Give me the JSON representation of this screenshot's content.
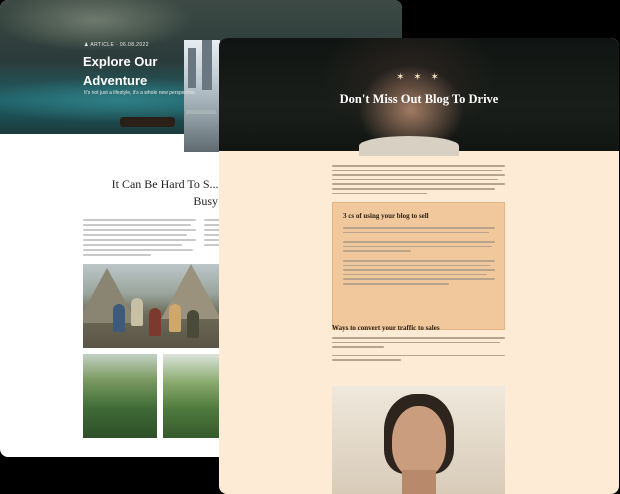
{
  "back_page": {
    "meta": "♟ ARTICLE   ·   06.08.2022",
    "hero_title": "Explore Our Adventure",
    "hero_subtitle": "It's not just a lifestyle, it's a whole new perspective.",
    "section_heading": "It Can Be Hard To S... The Busy W..."
  },
  "front_page": {
    "ornament": "✶ ✶ ✶",
    "hero_title": "Don't Miss Out Blog To Drive",
    "box_title": "3 cs of using your blog to sell",
    "convert_heading": "Ways to convert your traffic to sales"
  },
  "colors": {
    "front_background": "#fdebd6",
    "box_background": "#f0c89c",
    "back_background": "#ffffff"
  }
}
